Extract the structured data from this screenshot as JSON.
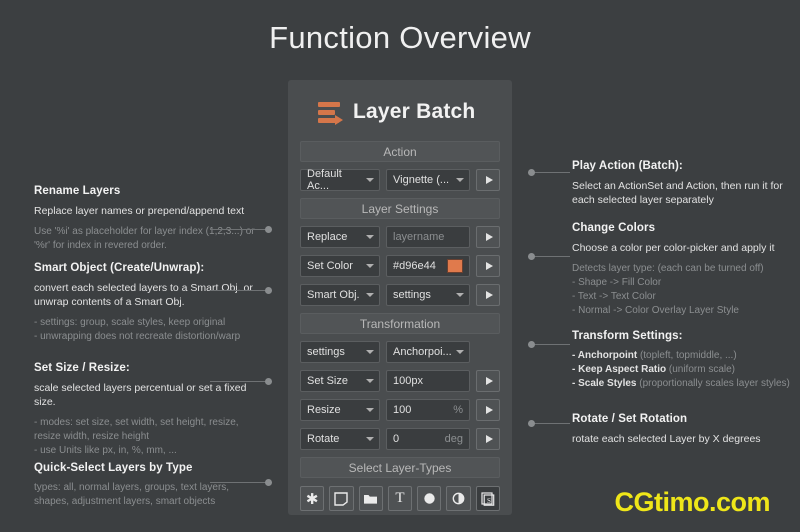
{
  "page": {
    "title": "Function Overview",
    "watermark": "CGtimo.com",
    "background_color": "#3c3f41",
    "accent_color": "#d5764a"
  },
  "panel": {
    "logo_icon": "layer-batch-logo-icon",
    "title": "Layer Batch",
    "sections": {
      "action": "Action",
      "layer_settings": "Layer Settings",
      "transformation": "Transformation",
      "select_layer_types": "Select Layer-Types"
    },
    "rows": {
      "action": {
        "actionset": "Default Ac...",
        "action": "Vignette (..."
      },
      "rename": {
        "mode": "Replace",
        "placeholder": "layername"
      },
      "color": {
        "mode": "Set Color",
        "value": "#d96e44",
        "swatch": "#e07a4c"
      },
      "smart_object": {
        "mode": "Smart Obj.",
        "settings": "settings"
      },
      "transform_settings": {
        "mode": "settings",
        "anchorpoint": "Anchorpoi..."
      },
      "set_size": {
        "mode": "Set Size",
        "value": "100px"
      },
      "resize": {
        "mode": "Resize",
        "value": "100",
        "unit": "%"
      },
      "rotate": {
        "mode": "Rotate",
        "value": "0",
        "unit": "deg"
      }
    },
    "layer_type_buttons": [
      {
        "name": "all-layers-icon",
        "glyph": "✱"
      },
      {
        "name": "normal-layer-icon",
        "glyph": ""
      },
      {
        "name": "group-folder-icon",
        "glyph": ""
      },
      {
        "name": "text-layer-icon",
        "glyph": "T"
      },
      {
        "name": "shape-layer-icon",
        "glyph": "●"
      },
      {
        "name": "adjustment-layer-icon",
        "glyph": ""
      },
      {
        "name": "smart-object-icon",
        "glyph": ""
      }
    ]
  },
  "annotations": {
    "left": [
      {
        "title": "Rename Layers",
        "main": "Replace layer names or prepend/append text",
        "sub": "Use '%i' as placeholder for layer index (1,2,3...) or '%r' for index in revered order."
      },
      {
        "title": "Smart Object (Create/Unwrap):",
        "main": "convert each selected layers to a Smart Obj. or unwrap contents of a Smart Obj.",
        "sub": "- settings: group, scale styles, keep original\n- unwrapping does not recreate distortion/warp"
      },
      {
        "title": "Set Size / Resize:",
        "main": "scale selected layers percentual or set a fixed size.",
        "sub": "- modes: set size, set width, set height, resize, resize width, resize height\n- use Units like px, in, %, mm, ..."
      },
      {
        "title": "Quick-Select Layers by Type",
        "main": "",
        "sub": "types: all, normal layers, groups, text layers, shapes, adjustment layers, smart objects"
      }
    ],
    "right": [
      {
        "title": "Play Action (Batch):",
        "main": "Select an ActionSet and Action, then run it for each selected layer separately",
        "sub": ""
      },
      {
        "title": "Change Colors",
        "main": "Choose a color per color-picker and apply it",
        "sub": "Detects layer type: (each can be turned off)\n- Shape -> Fill Color\n- Text -> Text Color\n- Normal -> Color Overlay Layer Style"
      },
      {
        "title": "Transform Settings:",
        "items": [
          {
            "label": "- Anchorpoint",
            "note": "(topleft, topmiddle, ...)"
          },
          {
            "label": "- Keep Aspect Ratio",
            "note": "(uniform scale)"
          },
          {
            "label": "- Scale Styles",
            "note": "(proportionally scales layer styles)"
          }
        ]
      },
      {
        "title": "Rotate / Set Rotation",
        "main": "rotate each selected Layer by X degrees",
        "sub": ""
      }
    ]
  }
}
